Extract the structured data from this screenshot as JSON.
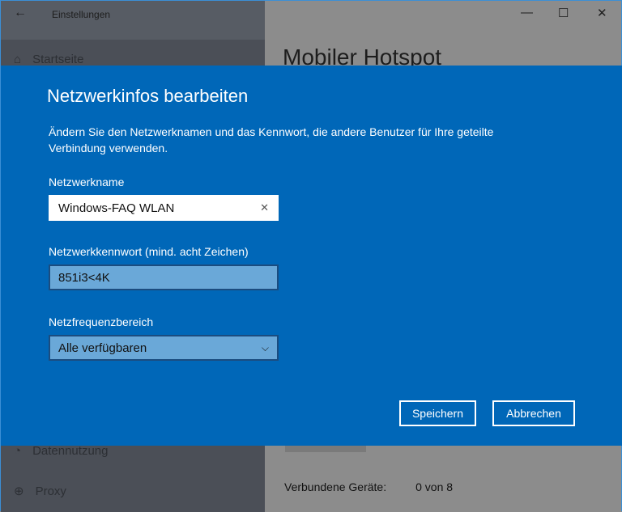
{
  "window": {
    "title": "Einstellungen",
    "minimize": "—",
    "maximize": "☐",
    "close": "✕"
  },
  "sidebar": {
    "items": [
      {
        "label": "Startseite",
        "icon": "home-icon"
      },
      {
        "label": "Datennutzung",
        "icon": "data-usage-icon"
      },
      {
        "label": "Proxy",
        "icon": "globe-icon"
      }
    ]
  },
  "main": {
    "title": "Mobiler Hotspot",
    "connected_label": "Verbundene Geräte:",
    "connected_value": "0 von 8"
  },
  "dialog": {
    "title": "Netzwerkinfos bearbeiten",
    "description": "Ändern Sie den Netzwerknamen und das Kennwort, die andere Benutzer für Ihre geteilte Verbindung verwenden.",
    "name_label": "Netzwerkname",
    "name_value": "Windows-FAQ WLAN",
    "password_label": "Netzwerkkennwort (mind. acht Zeichen)",
    "password_value": "851i3<4K",
    "band_label": "Netzfrequenzbereich",
    "band_value": "Alle verfügbaren",
    "save": "Speichern",
    "cancel": "Abbrechen"
  },
  "colors": {
    "accent": "#0067b8"
  }
}
